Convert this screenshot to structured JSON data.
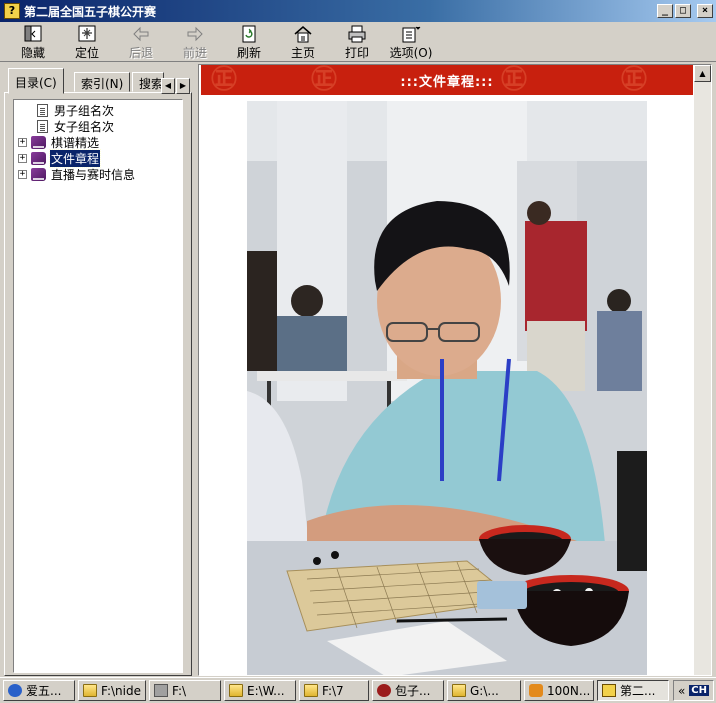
{
  "window": {
    "title": "第二届全国五子棋公开赛",
    "app_icon_glyph": "?",
    "minimize": "_",
    "maximize": "□",
    "close": "×"
  },
  "toolbar": {
    "buttons": [
      {
        "label": "隐藏",
        "icon": "hide-pane-icon",
        "enabled": true
      },
      {
        "label": "定位",
        "icon": "locate-icon",
        "enabled": true
      },
      {
        "label": "后退",
        "icon": "back-arrow-icon",
        "enabled": false
      },
      {
        "label": "前进",
        "icon": "forward-arrow-icon",
        "enabled": false
      },
      {
        "label": "刷新",
        "icon": "refresh-icon",
        "enabled": true
      },
      {
        "label": "主页",
        "icon": "home-icon",
        "enabled": true
      },
      {
        "label": "打印",
        "icon": "print-icon",
        "enabled": true
      },
      {
        "label": "选项(O)",
        "icon": "options-icon",
        "enabled": true
      }
    ]
  },
  "nav": {
    "tabs": [
      {
        "label": "目录(C)",
        "active": true
      },
      {
        "label": "索引(N)",
        "active": false
      },
      {
        "label": "搜索",
        "active": false
      }
    ],
    "tab_scroll_left": "◀",
    "tab_scroll_right": "▶",
    "tree": [
      {
        "label": "男子组名次",
        "type": "page",
        "indent": 1,
        "selected": false
      },
      {
        "label": "女子组名次",
        "type": "page",
        "indent": 1,
        "selected": false
      },
      {
        "label": "棋谱精选",
        "type": "book",
        "expander": "+",
        "selected": false
      },
      {
        "label": "文件章程",
        "type": "book",
        "expander": "+",
        "selected": true
      },
      {
        "label": "直播与赛时信息",
        "type": "book",
        "expander": "+",
        "selected": false
      }
    ]
  },
  "content": {
    "banner_title": ":::文件章程:::",
    "banner_motif": "㊣",
    "scroll_up": "▲",
    "photo_description_icon": "tournament-photo"
  },
  "taskbar": {
    "items": [
      {
        "label": "爱五...",
        "icon": "maxthon-icon",
        "active": false
      },
      {
        "label": "F:\\nide",
        "icon": "folder-icon",
        "active": false
      },
      {
        "label": "F:\\",
        "icon": "drive-icon",
        "active": false
      },
      {
        "label": "E:\\W...",
        "icon": "folder-icon",
        "active": false
      },
      {
        "label": "F:\\7",
        "icon": "folder-icon",
        "active": false
      },
      {
        "label": "包子...",
        "icon": "app-icon",
        "active": false
      },
      {
        "label": "G:\\...",
        "icon": "folder-icon",
        "active": false
      },
      {
        "label": "100N...",
        "icon": "app-icon",
        "active": false
      },
      {
        "label": "第二...",
        "icon": "help-icon",
        "active": true
      }
    ],
    "tray_chevron": "«",
    "ime": "CH"
  },
  "colors": {
    "title_bar": "#0a246a",
    "banner_red": "#c8200e",
    "selection": "#0a246a",
    "window_face": "#d4d0c8"
  }
}
